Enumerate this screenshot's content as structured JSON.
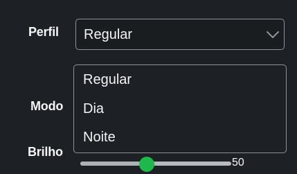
{
  "fields": {
    "profile_label": "Perfil",
    "mode_label": "Modo",
    "brightness_label": "Brilho"
  },
  "profile_select": {
    "selected": "Regular",
    "expanded": true,
    "options": [
      "Regular",
      "Dia",
      "Noite"
    ]
  },
  "brightness": {
    "value_text": "50",
    "level": 0.5
  },
  "icons": {
    "dropdown": "chevron-down-icon"
  },
  "colors": {
    "background": "#1d2024",
    "border": "#8f949a",
    "text": "#f3f4f5",
    "slider_thumb": "#1fb84a"
  }
}
